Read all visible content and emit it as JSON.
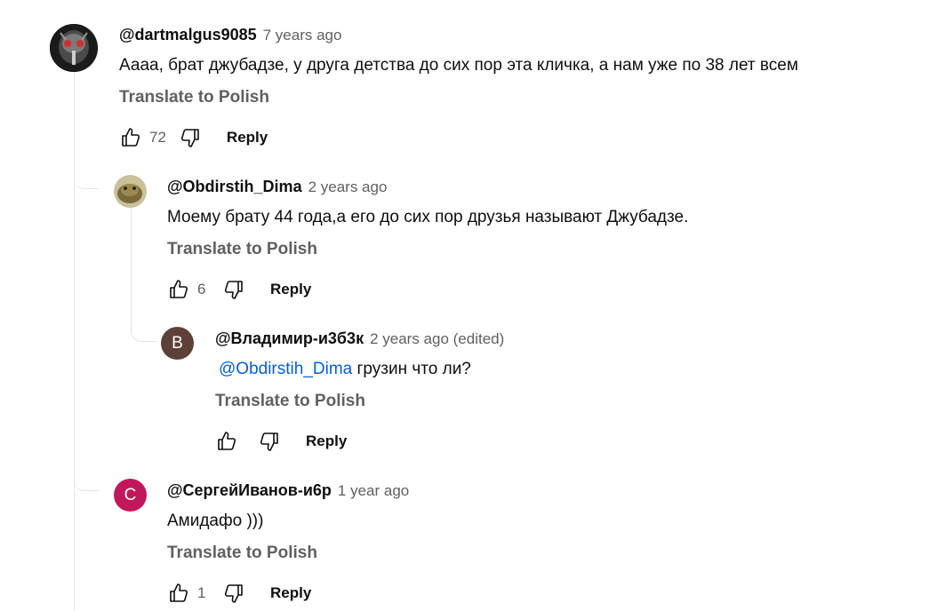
{
  "comments": [
    {
      "author": "@dartmalgus9085",
      "time": "7 years ago",
      "text": "Аааа, брат джубадзе, у друга детства до сих пор эта кличка, а нам уже по 38 лет всем",
      "translate": "Translate to Polish",
      "likes": "72",
      "reply": "Reply",
      "avatar_kind": "image"
    },
    {
      "author": "@Obdirstih_Dima",
      "time": "2 years ago",
      "text": "Моему брату 44 года,а его до сих пор друзья называют Джубадзе.",
      "translate": "Translate to Polish",
      "likes": "6",
      "reply": "Reply",
      "avatar_kind": "image"
    },
    {
      "author": "@Владимир-и3б3к",
      "time": "2 years ago (edited)",
      "mention": "@Obdirstih_Dima",
      "text": " грузин что ли?",
      "translate": "Translate to Polish",
      "likes": "",
      "reply": "Reply",
      "avatar_letter": "В",
      "avatar_color": "#5d4037"
    },
    {
      "author": "@СергейИванов-и6р",
      "time": "1 year ago",
      "text": "Амидафо )))",
      "translate": "Translate to Polish",
      "likes": "1",
      "reply": "Reply",
      "avatar_letter": "С",
      "avatar_color": "#c2185b"
    }
  ],
  "icons": {
    "like": "thumb-up-icon",
    "dislike": "thumb-down-icon"
  }
}
